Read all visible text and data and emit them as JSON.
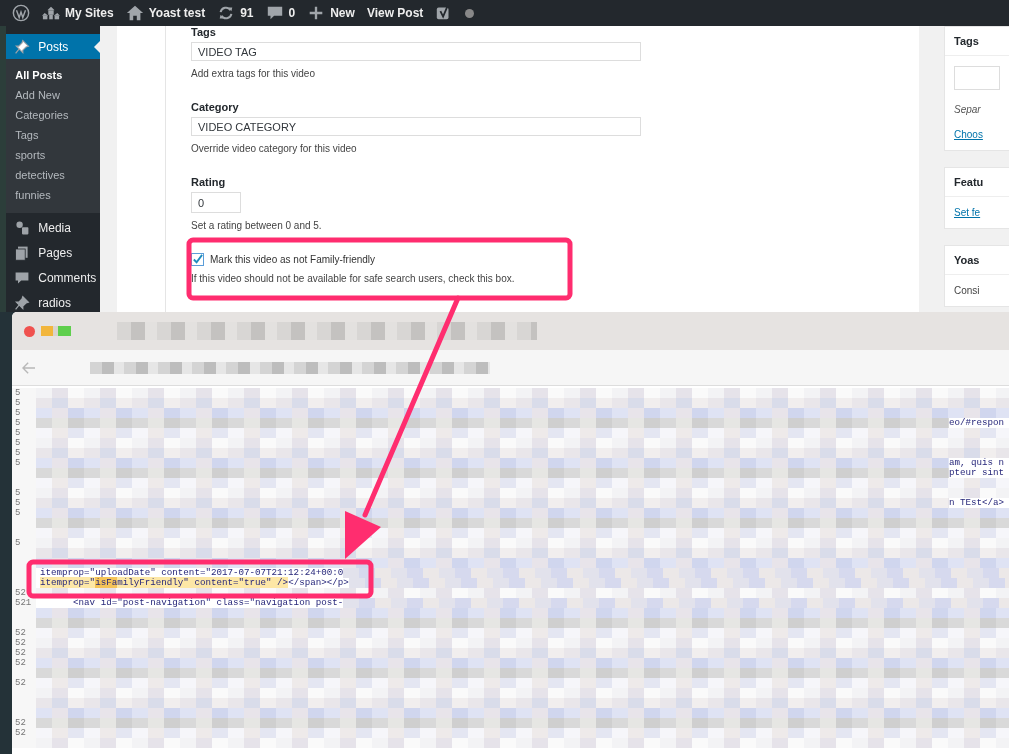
{
  "admin_bar": {
    "items": [
      {
        "kind": "wordpress"
      },
      {
        "kind": "sites",
        "label": "My Sites"
      },
      {
        "kind": "home",
        "label": "Yoast test"
      },
      {
        "kind": "updates",
        "label": "91"
      },
      {
        "kind": "comments",
        "label": "0"
      },
      {
        "kind": "new",
        "label": "New"
      },
      {
        "kind": "text",
        "label": "View Post"
      },
      {
        "kind": "yoast"
      },
      {
        "kind": "dot"
      }
    ]
  },
  "sidebar": {
    "menu": [
      {
        "label": "Posts",
        "kind": "pin",
        "selected": true,
        "submenu": [
          {
            "label": "All Posts",
            "selected": true
          },
          {
            "label": "Add New",
            "selected": false
          },
          {
            "label": "Categories",
            "selected": false
          },
          {
            "label": "Tags",
            "selected": false
          },
          {
            "label": "sports",
            "selected": false
          },
          {
            "label": "detectives",
            "selected": false
          },
          {
            "label": "funnies",
            "selected": false
          }
        ]
      },
      {
        "label": "Media",
        "kind": "media",
        "selected": false
      },
      {
        "label": "Pages",
        "kind": "pages",
        "selected": false
      },
      {
        "label": "Comments",
        "kind": "comment",
        "selected": false
      },
      {
        "label": "radios",
        "kind": "pin",
        "selected": false
      }
    ]
  },
  "video_fields": [
    {
      "kind": "text",
      "label": "Tags",
      "value": "VIDEO TAG",
      "help": "Add extra tags for this video"
    },
    {
      "kind": "text",
      "label": "Category",
      "value": "VIDEO CATEGORY",
      "help": "Override video category for this video"
    },
    {
      "kind": "number",
      "label": "Rating",
      "value": "0",
      "help": "Set a rating between 0 and 5."
    },
    {
      "kind": "checkbox",
      "label": "Mark this video as not Family-friendly",
      "checked": true,
      "help": "If this video should not be available for safe search users, check this box."
    }
  ],
  "side_boxes": [
    {
      "title": "Tags",
      "items": [
        {
          "kind": "field"
        },
        {
          "kind": "hint",
          "text": "Separ"
        },
        {
          "kind": "link",
          "text": "Choos"
        }
      ]
    },
    {
      "title": "Featu",
      "items": [
        {
          "kind": "link",
          "text": "Set fe"
        }
      ]
    },
    {
      "title": "Yoas",
      "items": [
        {
          "kind": "text",
          "text": "Consi"
        }
      ]
    }
  ],
  "source_window": {
    "rows": [
      {
        "kind": "blurred",
        "number": "5"
      },
      {
        "kind": "blurred",
        "number": "5"
      },
      {
        "kind": "blurred",
        "number": "5"
      },
      {
        "kind": "blurred",
        "number": "5",
        "tail": "eo/#respon"
      },
      {
        "kind": "blurred",
        "number": "5"
      },
      {
        "kind": "blurred",
        "number": "5"
      },
      {
        "kind": "blurred",
        "number": "5"
      },
      {
        "kind": "blurred",
        "number": "5",
        "tail": "am, quis n"
      },
      {
        "kind": "blurred",
        "tail": "pteur sint"
      },
      {
        "kind": "blurred"
      },
      {
        "kind": "blurred",
        "number": "5"
      },
      {
        "kind": "blurred",
        "number": "5",
        "tail": "n TEst</a>"
      },
      {
        "kind": "blurred",
        "number": "5"
      },
      {
        "kind": "blurred"
      },
      {
        "kind": "blurred"
      },
      {
        "kind": "blurred",
        "number": "5"
      },
      {
        "kind": "blurred"
      },
      {
        "kind": "blurred"
      },
      {
        "kind": "code",
        "segments": [
          {
            "text": "itemprop=\"uploadDate\" content=\"2017-07-07T21:12:24+00:0",
            "kind": "plain"
          }
        ]
      },
      {
        "kind": "code",
        "segments": [
          {
            "text": "itemprop=\"",
            "kind": "highlight"
          },
          {
            "text": "isFa",
            "kind": "match"
          },
          {
            "text": "milyFriendly\" content=\"true\" />",
            "kind": "highlight"
          },
          {
            "text": "</span></p>",
            "kind": "plain"
          }
        ]
      },
      {
        "kind": "blurred",
        "number": "52"
      },
      {
        "kind": "code",
        "number": "521",
        "segments": [
          {
            "text": "      <nav id=\"post-navigation\" class=\"navigation post-",
            "kind": "plain"
          }
        ]
      },
      {
        "kind": "blurred"
      },
      {
        "kind": "blurred"
      },
      {
        "kind": "blurred",
        "number": "52"
      },
      {
        "kind": "blurred",
        "number": "52"
      },
      {
        "kind": "blurred",
        "number": "52"
      },
      {
        "kind": "blurred",
        "number": "52"
      },
      {
        "kind": "blurred"
      },
      {
        "kind": "blurred",
        "number": "52"
      },
      {
        "kind": "blurred"
      },
      {
        "kind": "blurred"
      },
      {
        "kind": "blurred"
      },
      {
        "kind": "blurred",
        "number": "52"
      },
      {
        "kind": "blurred",
        "number": "52"
      },
      {
        "kind": "blurred"
      }
    ]
  }
}
